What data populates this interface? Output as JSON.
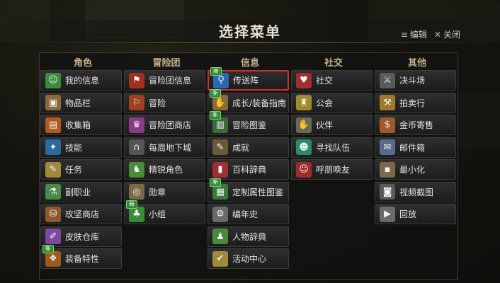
{
  "title": "选择菜单",
  "top_actions": {
    "edit_label": "编辑",
    "close_label": "关闭"
  },
  "columns": [
    {
      "header": "角色",
      "items": [
        {
          "label": "我的信息",
          "icon": "person-icon",
          "color": "#3a8c3a",
          "glyph": "☺",
          "new": false
        },
        {
          "label": "物品栏",
          "icon": "bag-icon",
          "color": "#8a6a3a",
          "glyph": "▣",
          "new": false
        },
        {
          "label": "收集箱",
          "icon": "chest-icon",
          "color": "#b05a20",
          "glyph": "▤",
          "new": false
        },
        {
          "label": "技能",
          "icon": "skill-spark-icon",
          "color": "#2a6aa0",
          "glyph": "✦",
          "new": false
        },
        {
          "label": "任务",
          "icon": "scroll-icon",
          "color": "#a08a3a",
          "glyph": "✎",
          "new": false
        },
        {
          "label": "副职业",
          "icon": "potion-icon",
          "color": "#4a8a4a",
          "glyph": "⚗",
          "new": false
        },
        {
          "label": "玫坚商店",
          "icon": "shop-chest-icon",
          "color": "#8a5a2a",
          "glyph": "⛁",
          "new": false
        },
        {
          "label": "皮肤仓库",
          "icon": "brush-icon",
          "color": "#7a4aa0",
          "glyph": "✐",
          "new": false
        },
        {
          "label": "装备特性",
          "icon": "equip-trait-icon",
          "color": "#a05a20",
          "glyph": "❖",
          "new": true
        }
      ]
    },
    {
      "header": "冒险团",
      "items": [
        {
          "label": "冒险团信息",
          "icon": "banner-icon",
          "color": "#a03020",
          "glyph": "⚑",
          "new": false
        },
        {
          "label": "冒险",
          "icon": "flag-icon",
          "color": "#a04020",
          "glyph": "⚐",
          "new": false
        },
        {
          "label": "冒险团商店",
          "icon": "merchant-icon",
          "color": "#8a3a8a",
          "glyph": "♛",
          "new": false
        },
        {
          "label": "每周地下城",
          "icon": "gate-icon",
          "color": "#555555",
          "glyph": "∩",
          "new": false
        },
        {
          "label": "精锐角色",
          "icon": "elite-icon",
          "color": "#4a8a3a",
          "glyph": "♞",
          "new": false
        },
        {
          "label": "勋章",
          "icon": "medal-icon",
          "color": "#7a6a4a",
          "glyph": "◎",
          "new": false
        },
        {
          "label": "小组",
          "icon": "group-icon",
          "color": "#3a8a3a",
          "glyph": "♣",
          "new": true
        }
      ]
    },
    {
      "header": "信息",
      "items": [
        {
          "label": "传送阵",
          "icon": "portal-icon",
          "color": "#2a6ab0",
          "glyph": "⚲",
          "new": true,
          "highlight": true
        },
        {
          "label": "成长/装备指南",
          "icon": "guide-icon",
          "color": "#8a6a3a",
          "glyph": "✋",
          "new": true
        },
        {
          "label": "冒险图鉴",
          "icon": "codex-icon",
          "color": "#3a6a3a",
          "glyph": "▥",
          "new": true
        },
        {
          "label": "成就",
          "icon": "achievement-icon",
          "color": "#6a5a3a",
          "glyph": "✎",
          "new": false
        },
        {
          "label": "百科辞典",
          "icon": "encyclopedia-icon",
          "color": "#a03030",
          "glyph": "▮",
          "new": false
        },
        {
          "label": "定制属性图鉴",
          "icon": "custom-codex-icon",
          "color": "#3a7a3a",
          "glyph": "▦",
          "new": true
        },
        {
          "label": "编年史",
          "icon": "gear-icon",
          "color": "#6a6a6a",
          "glyph": "⚙",
          "new": false
        },
        {
          "label": "人物辞典",
          "icon": "character-book-icon",
          "color": "#4a8a3a",
          "glyph": "♟",
          "new": false
        },
        {
          "label": "活动中心",
          "icon": "checklist-icon",
          "color": "#a08a3a",
          "glyph": "✔",
          "new": false
        }
      ]
    },
    {
      "header": "社交",
      "items": [
        {
          "label": "社交",
          "icon": "social-shield-icon",
          "color": "#a03030",
          "glyph": "♥",
          "new": false
        },
        {
          "label": "公会",
          "icon": "guild-eagle-icon",
          "color": "#a08a2a",
          "glyph": "♜",
          "new": false
        },
        {
          "label": "伙伴",
          "icon": "handshake-icon",
          "color": "#6a6a5a",
          "glyph": "✋",
          "new": false
        },
        {
          "label": "寻找队伍",
          "icon": "party-icon",
          "color": "#2a8a6a",
          "glyph": "☻",
          "new": false
        },
        {
          "label": "呼朋唤友",
          "icon": "friend-call-icon",
          "color": "#a02a2a",
          "glyph": "☺",
          "new": false
        }
      ]
    },
    {
      "header": "其他",
      "items": [
        {
          "label": "决斗场",
          "icon": "swords-icon",
          "color": "#5a5a5a",
          "glyph": "⚔",
          "new": false
        },
        {
          "label": "拍卖行",
          "icon": "gavel-icon",
          "color": "#a07a2a",
          "glyph": "⚒",
          "new": false
        },
        {
          "label": "金币寄售",
          "icon": "coin-bag-icon",
          "color": "#a05a2a",
          "glyph": "$",
          "new": false
        },
        {
          "label": "邮件箱",
          "icon": "mail-icon",
          "color": "#5a6a8a",
          "glyph": "✉",
          "new": false
        },
        {
          "label": "最小化",
          "icon": "minimize-icon",
          "color": "#7a6a4a",
          "glyph": "▪",
          "new": false
        },
        {
          "label": "视频截图",
          "icon": "camera-icon",
          "color": "#5a5a5a",
          "glyph": "◙",
          "new": false
        },
        {
          "label": "回放",
          "icon": "replay-icon",
          "color": "#6a6a6a",
          "glyph": "▶",
          "new": false
        }
      ]
    }
  ],
  "new_badge_label": "新"
}
